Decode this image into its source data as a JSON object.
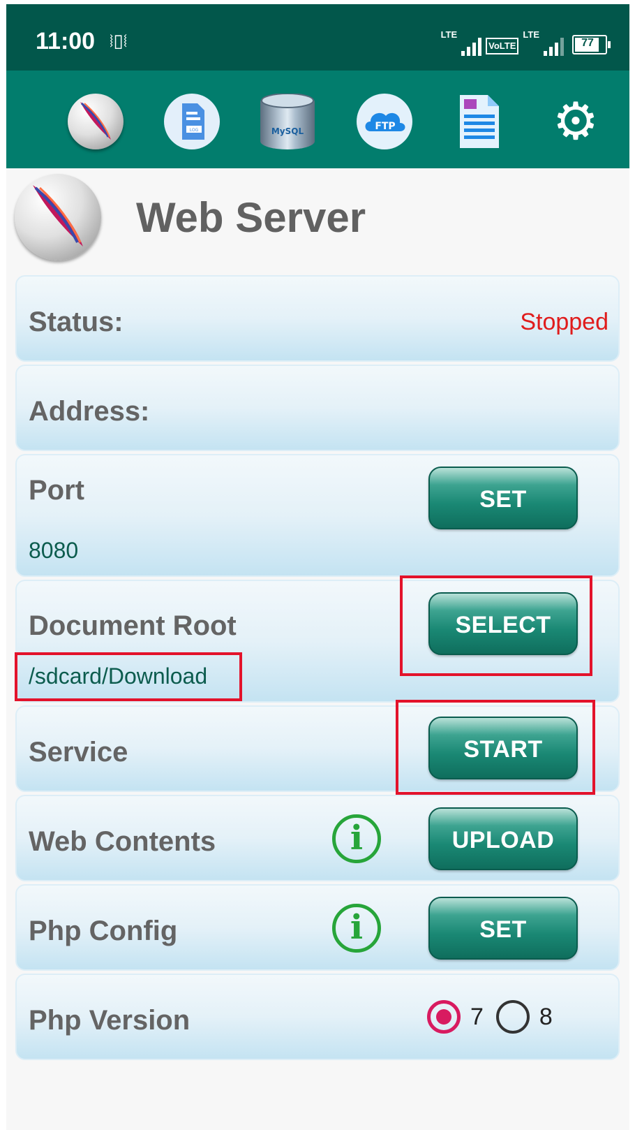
{
  "status_bar": {
    "time": "11:00",
    "vibrate_glyph": "⧘▯⧙",
    "network_1": "LTE",
    "volte": "VoLTE",
    "network_2": "LTE",
    "battery": "77"
  },
  "toolbar": {
    "icons": [
      "apache-feather-icon",
      "log-file-icon",
      "mysql-database-icon",
      "ftp-cloud-icon",
      "document-icon",
      "settings-gear-icon"
    ]
  },
  "header": {
    "title": "Web Server"
  },
  "rows": {
    "status": {
      "label": "Status:",
      "value": "Stopped"
    },
    "address": {
      "label": "Address:"
    },
    "port": {
      "label": "Port",
      "value": "8080",
      "button": "SET"
    },
    "document_root": {
      "label": "Document Root",
      "value": "/sdcard/Download",
      "button": "SELECT"
    },
    "service": {
      "label": "Service",
      "button": "START"
    },
    "web_contents": {
      "label": "Web Contents",
      "button": "UPLOAD"
    },
    "php_config": {
      "label": "Php Config",
      "button": "SET"
    },
    "php_version": {
      "label": "Php Version",
      "options": [
        "7",
        "8"
      ],
      "selected": "7"
    }
  },
  "colors": {
    "status_bar_bg": "#02574b",
    "toolbar_bg": "#027d6d",
    "stopped_text": "#e01c1c",
    "highlight_box": "#e3132b",
    "radio_selected": "#d81b60"
  }
}
